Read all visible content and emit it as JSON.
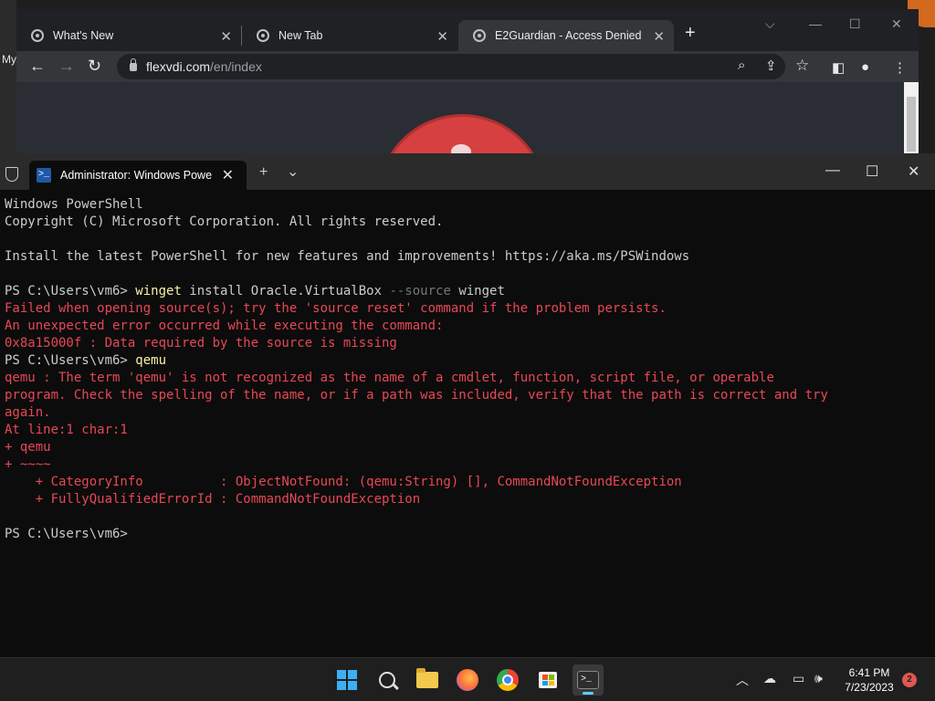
{
  "desktop": {
    "label": "My"
  },
  "browser": {
    "tabs": [
      {
        "title": "What's New"
      },
      {
        "title": "New Tab"
      },
      {
        "title": "E2Guardian - Access Denied"
      }
    ],
    "url": {
      "host": "flexvdi.com",
      "path": "/en/index"
    }
  },
  "terminal": {
    "tab_title": "Administrator: Windows Powe",
    "lines": [
      {
        "segments": [
          {
            "t": "Windows PowerShell",
            "c": ""
          }
        ]
      },
      {
        "segments": [
          {
            "t": "Copyright (C) Microsoft Corporation. All rights reserved.",
            "c": ""
          }
        ]
      },
      {
        "segments": [
          {
            "t": "",
            "c": ""
          }
        ]
      },
      {
        "segments": [
          {
            "t": "Install the latest PowerShell for new features and improvements! https://aka.ms/PSWindows",
            "c": ""
          }
        ]
      },
      {
        "segments": [
          {
            "t": "",
            "c": ""
          }
        ]
      },
      {
        "segments": [
          {
            "t": "PS C:\\Users\\vm6> ",
            "c": ""
          },
          {
            "t": "winget",
            "c": "cmd"
          },
          {
            "t": " install Oracle.VirtualBox ",
            "c": ""
          },
          {
            "t": "--source",
            "c": "param"
          },
          {
            "t": " winget",
            "c": ""
          }
        ]
      },
      {
        "segments": [
          {
            "t": "Failed when opening source(s); try the 'source reset' command if the problem persists.",
            "c": "err"
          }
        ]
      },
      {
        "segments": [
          {
            "t": "An unexpected error occurred while executing the command:",
            "c": "err"
          }
        ]
      },
      {
        "segments": [
          {
            "t": "0x8a15000f : Data required by the source is missing",
            "c": "err"
          }
        ]
      },
      {
        "segments": [
          {
            "t": "PS C:\\Users\\vm6> ",
            "c": ""
          },
          {
            "t": "qemu",
            "c": "cmd"
          }
        ]
      },
      {
        "segments": [
          {
            "t": "qemu : The term 'qemu' is not recognized as the name of a cmdlet, function, script file, or operable",
            "c": "err"
          }
        ]
      },
      {
        "segments": [
          {
            "t": "program. Check the spelling of the name, or if a path was included, verify that the path is correct and try",
            "c": "err"
          }
        ]
      },
      {
        "segments": [
          {
            "t": "again.",
            "c": "err"
          }
        ]
      },
      {
        "segments": [
          {
            "t": "At line:1 char:1",
            "c": "err"
          }
        ]
      },
      {
        "segments": [
          {
            "t": "+ qemu",
            "c": "err"
          }
        ]
      },
      {
        "segments": [
          {
            "t": "+ ~~~~",
            "c": "err"
          }
        ]
      },
      {
        "segments": [
          {
            "t": "    + CategoryInfo          : ObjectNotFound: (qemu:String) [], CommandNotFoundException",
            "c": "err"
          }
        ]
      },
      {
        "segments": [
          {
            "t": "    + FullyQualifiedErrorId : CommandNotFoundException",
            "c": "err"
          }
        ]
      },
      {
        "segments": [
          {
            "t": "",
            "c": ""
          }
        ]
      },
      {
        "segments": [
          {
            "t": "PS C:\\Users\\vm6>",
            "c": ""
          }
        ]
      }
    ]
  },
  "taskbar": {
    "time": "6:41 PM",
    "date": "7/23/2023",
    "notification_count": "2"
  }
}
